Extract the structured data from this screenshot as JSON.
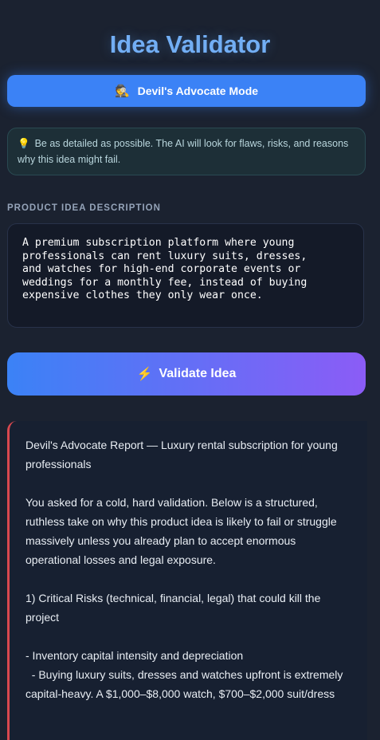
{
  "app": {
    "title": "Idea Validator"
  },
  "mode_button": {
    "icon": "detective-icon",
    "icon_glyph": "🕵",
    "label": "Devil's Advocate Mode"
  },
  "tip": {
    "icon": "lightbulb-icon",
    "icon_glyph": "💡",
    "text": "Be as detailed as possible. The AI will look for flaws, risks, and reasons why this idea might fail."
  },
  "input": {
    "label": "PRODUCT IDEA DESCRIPTION",
    "value": "A premium subscription platform where young\nprofessionals can rent luxury suits, dresses,\nand watches for high-end corporate events or\nweddings for a monthly fee, instead of buying\nexpensive clothes they only wear once."
  },
  "validate_button": {
    "icon": "lightning-icon",
    "icon_glyph": "⚡",
    "label": "Validate Idea"
  },
  "report": {
    "heading": "Devil's Advocate Report — Luxury rental subscription for young professionals",
    "intro": "You asked for a cold, hard validation. Below is a structured, ruthless take on why this product idea is likely to fail or struggle massively unless you already plan to accept enormous operational losses and legal exposure.",
    "section1_title": "1) Critical Risks (technical, financial, legal) that could kill the project",
    "bullet1": "- Inventory capital intensity and depreciation",
    "bullet1_detail": "  - Buying luxury suits, dresses and watches upfront is extremely capital-heavy. A $1,000–$8,000 watch, $700–$2,000 suit/dress"
  },
  "colors": {
    "background": "#1b2230",
    "accent_blue": "#3b82f6",
    "accent_purple": "#8b5cf6",
    "report_border": "#d9484f"
  }
}
